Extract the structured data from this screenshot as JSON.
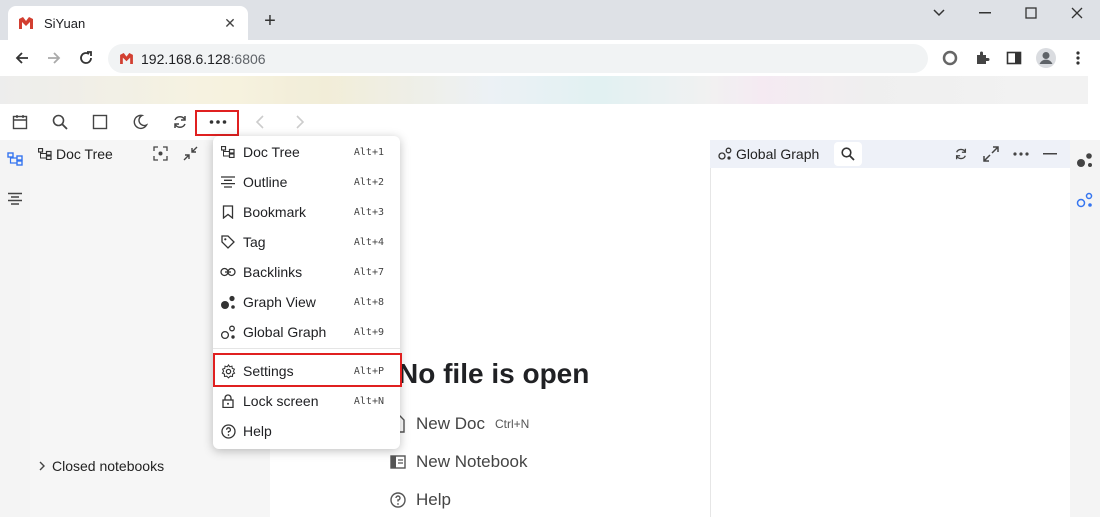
{
  "browser": {
    "tab_title": "SiYuan",
    "address_host": "192.168.6.128",
    "address_port": ":6806"
  },
  "doctree": {
    "title": "Doc Tree",
    "closed_notebooks": "Closed notebooks"
  },
  "editor": {
    "empty_title": "No file is open",
    "new_doc": "New Doc",
    "new_doc_hotkey": "Ctrl+N",
    "new_notebook": "New Notebook",
    "help": "Help"
  },
  "graph": {
    "title": "Global Graph"
  },
  "menu": {
    "items": [
      {
        "label": "Doc Tree",
        "key": "Alt+1",
        "icon": "doc-tree-icon"
      },
      {
        "label": "Outline",
        "key": "Alt+2",
        "icon": "outline-icon"
      },
      {
        "label": "Bookmark",
        "key": "Alt+3",
        "icon": "bookmark-icon"
      },
      {
        "label": "Tag",
        "key": "Alt+4",
        "icon": "tag-icon"
      },
      {
        "label": "Backlinks",
        "key": "Alt+7",
        "icon": "link-icon"
      },
      {
        "label": "Graph View",
        "key": "Alt+8",
        "icon": "graph-icon"
      },
      {
        "label": "Global Graph",
        "key": "Alt+9",
        "icon": "global-graph-icon"
      },
      {
        "label": "Settings",
        "key": "Alt+P",
        "icon": "gear-icon"
      },
      {
        "label": "Lock screen",
        "key": "Alt+N",
        "icon": "lock-icon"
      },
      {
        "label": "Help",
        "key": "",
        "icon": "help-icon"
      }
    ]
  },
  "colors": {
    "accent": "#3575f0",
    "highlight": "#e02020",
    "brand": "#d23f31"
  }
}
